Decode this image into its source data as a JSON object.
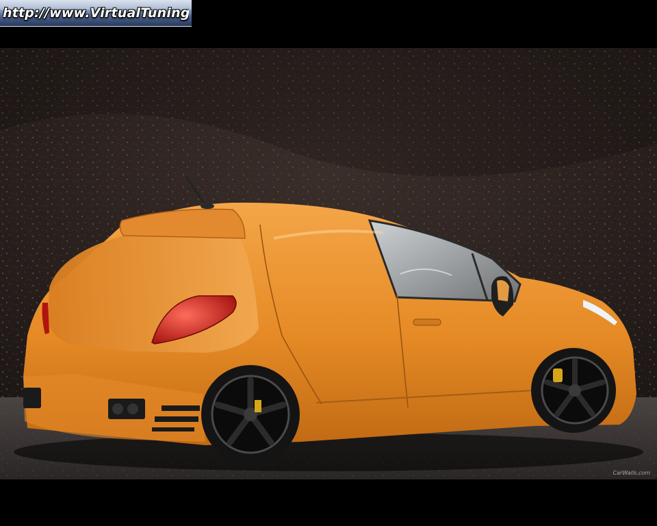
{
  "banner": {
    "text": "http://www.VirtualTuning.IT"
  },
  "watermark": {
    "text": "CarWalls.com"
  },
  "colors": {
    "frame": "#000000",
    "car_body": "#e8902c",
    "car_shadow": "#b86516",
    "wall": "#2b2220",
    "ground": "#3b3634"
  },
  "scene": {
    "subject": "orange-hatchback-car",
    "background": "dark-gravel-wall"
  }
}
